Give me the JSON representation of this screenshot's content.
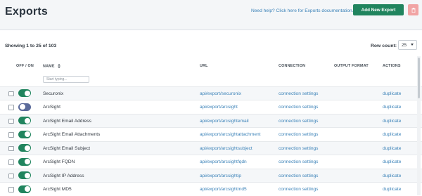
{
  "header": {
    "title": "Exports",
    "help_text": "Need help? Click here for Exports documentation.",
    "add_label": "Add New Export",
    "accent_color": "#20845e",
    "delete_color": "#f1a4a4",
    "delete_icon": "trash-icon"
  },
  "summary": "Showing 1 to 25 of 103",
  "row_count": {
    "label": "Row count:",
    "selected": "25"
  },
  "columns": {
    "toggle": "OFF / ON",
    "name": "NAME",
    "url": "URL",
    "connection": "CONNECTION",
    "output_format": "OUTPUT FORMAT",
    "actions": "ACTIONS"
  },
  "filter": {
    "placeholder": "Start typing..."
  },
  "rows": [
    {
      "enabled": true,
      "name": "Securonix",
      "url": "api/export/securonix",
      "connection": "connection settings",
      "output_format": "",
      "action": "duplicate"
    },
    {
      "enabled": false,
      "name": "ArcSight",
      "url": "api/export/arcsight",
      "connection": "connection settings",
      "output_format": "",
      "action": "duplicate"
    },
    {
      "enabled": true,
      "name": "ArcSight Email Address",
      "url": "api/export/arcsightemail",
      "connection": "connection settings",
      "output_format": "",
      "action": "duplicate"
    },
    {
      "enabled": true,
      "name": "ArcSight Email Attachments",
      "url": "api/export/arcsightattachment",
      "connection": "connection settings",
      "output_format": "",
      "action": "duplicate"
    },
    {
      "enabled": true,
      "name": "ArcSight Email Subject",
      "url": "api/export/arcsightsubject",
      "connection": "connection settings",
      "output_format": "",
      "action": "duplicate"
    },
    {
      "enabled": true,
      "name": "ArcSight FQDN",
      "url": "api/export/arcsightfqdn",
      "connection": "connection settings",
      "output_format": "",
      "action": "duplicate"
    },
    {
      "enabled": true,
      "name": "ArcSight IP Address",
      "url": "api/export/arcsightip",
      "connection": "connection settings",
      "output_format": "",
      "action": "duplicate"
    },
    {
      "enabled": true,
      "name": "ArcSight MD5",
      "url": "api/export/arcsightmd5",
      "connection": "connection settings",
      "output_format": "",
      "action": "duplicate"
    }
  ]
}
